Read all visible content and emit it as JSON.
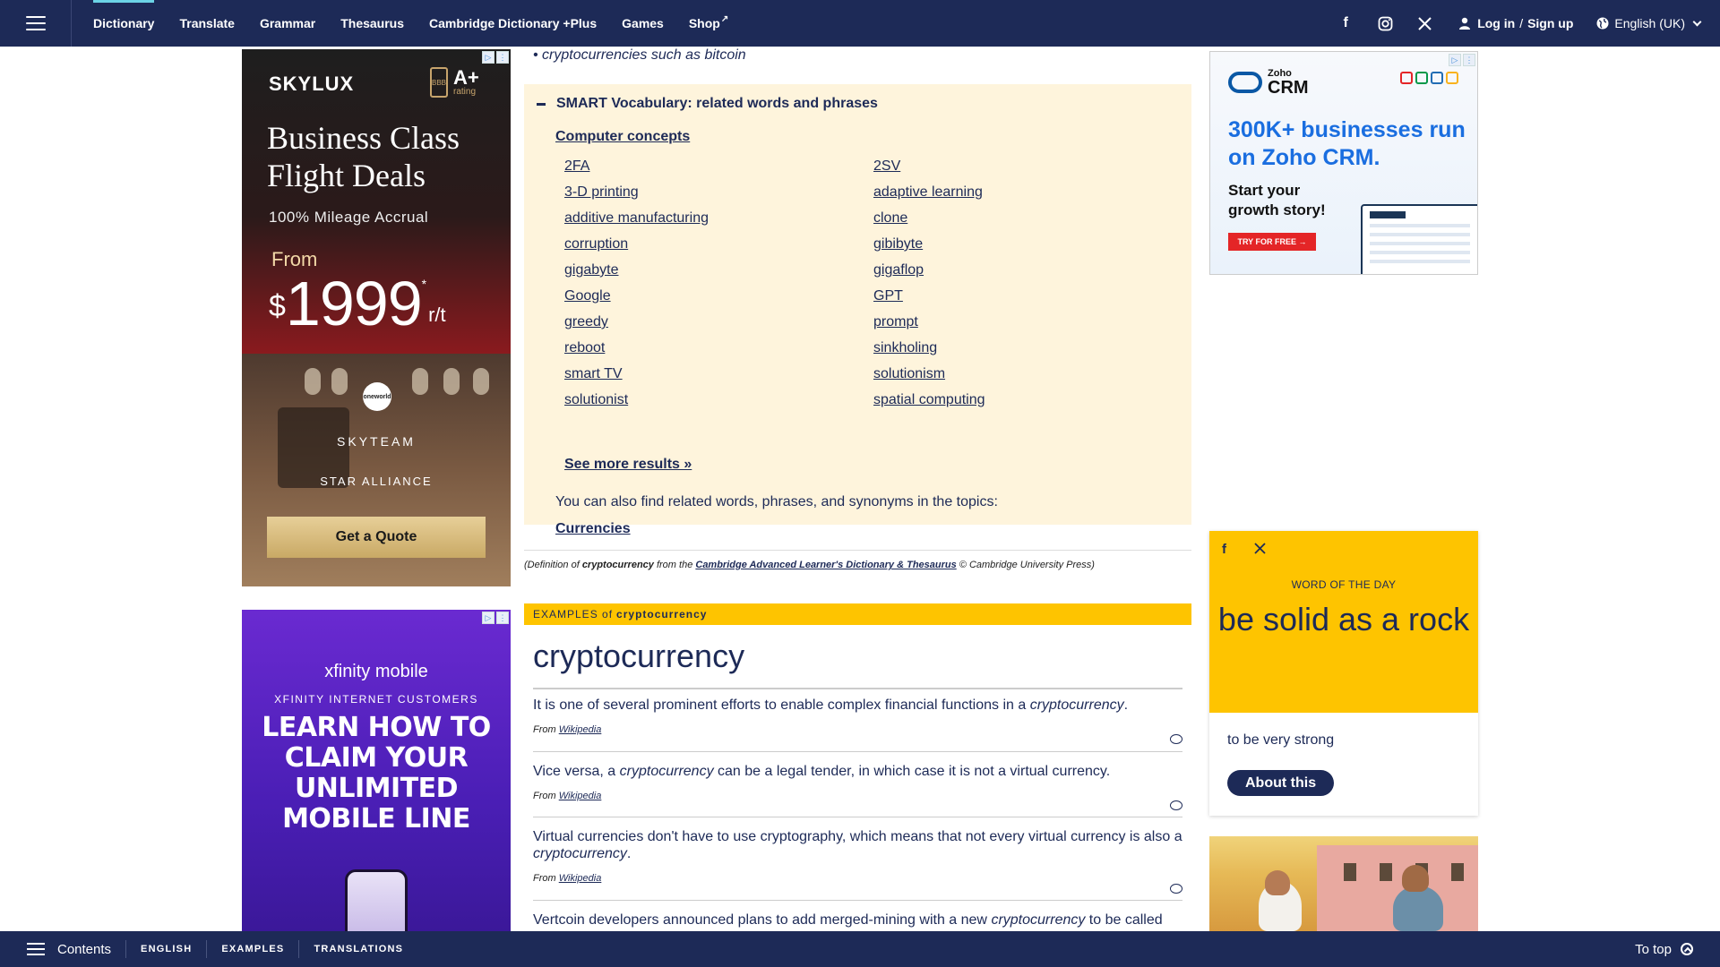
{
  "nav": {
    "items": [
      {
        "label": "Dictionary",
        "active": true
      },
      {
        "label": "Translate"
      },
      {
        "label": "Grammar"
      },
      {
        "label": "Thesaurus"
      },
      {
        "label": "Cambridge Dictionary +Plus"
      },
      {
        "label": "Games"
      },
      {
        "label": "Shop"
      }
    ],
    "social": [
      "facebook-icon",
      "instagram-icon",
      "x-icon"
    ],
    "login_label": "Log in",
    "signup_label": "Sign up",
    "language_label": "English (UK)"
  },
  "ads": {
    "skylux": {
      "brand": "SKYLUX",
      "rating_grade": "A+",
      "rating_word": "rating",
      "bbb": "BBB",
      "headline": "Business Class Flight Deals",
      "subtitle": "100% Mileage Accrual",
      "from": "From",
      "currency": "$",
      "price": "1999",
      "asterisk": "*",
      "suffix": "r/t",
      "oneworld": "oneworld",
      "skyteam": "SKYTEAM",
      "star_alliance": "STAR ALLIANCE",
      "cta": "Get a Quote"
    },
    "xfinity": {
      "logo": "xfinity mobile",
      "subtitle": "XFINITY INTERNET CUSTOMERS",
      "headline": "LEARN HOW TO CLAIM YOUR UNLIMITED MOBILE LINE"
    },
    "zoho": {
      "logo_small": "Zoho",
      "logo_big": "CRM",
      "headline": "300K+ businesses run on Zoho CRM.",
      "subtitle": "Start your growth story!",
      "cta": "TRY FOR FREE →",
      "colors": [
        "#e42527",
        "#089949",
        "#226db4",
        "#f9b21d"
      ]
    }
  },
  "entry": {
    "bullet": "cryptocurrencies such as bitcoin",
    "smart_title": "SMART Vocabulary: related words and phrases",
    "topic": "Computer concepts",
    "words_left": [
      "2FA",
      "3-D printing",
      "additive manufacturing",
      "corruption",
      "gigabyte",
      "Google",
      "greedy",
      "reboot",
      "smart TV",
      "solutionist"
    ],
    "words_right": [
      "2SV",
      "adaptive learning",
      "clone",
      "gibibyte",
      "gigaflop",
      "GPT",
      "prompt",
      "sinkholing",
      "solutionism",
      "spatial computing"
    ],
    "see_more": "See more results »",
    "also_text": "You can also find related words, phrases, and synonyms in the topics:",
    "also_topic": "Currencies",
    "source_pre": "(Definition of ",
    "source_word": "cryptocurrency",
    "source_mid": " from the ",
    "source_link": "Cambridge Advanced Learner's Dictionary & Thesaurus",
    "source_post": " © Cambridge University Press)"
  },
  "examples": {
    "bar_prefix": "EXAMPLES of",
    "bar_word": "cryptocurrency",
    "word": "cryptocurrency",
    "from_label": "From",
    "items": [
      {
        "pre": "It is one of several prominent efforts to enable complex financial functions in a ",
        "term": "cryptocurrency",
        "post": ".",
        "source": "Wikipedia"
      },
      {
        "pre": "Vice versa, a ",
        "term": "cryptocurrency",
        "post": " can be a legal tender, in which case it is not a virtual currency.",
        "source": "Wikipedia"
      },
      {
        "pre": "Virtual currencies don't have to use cryptography, which means that not every virtual currency is also a ",
        "term": "cryptocurrency",
        "post": ".",
        "source": "Wikipedia"
      },
      {
        "pre": "Vertcoin developers announced plans to add merged-mining with a new ",
        "term": "cryptocurrency",
        "post": " to be called",
        "source": ""
      }
    ]
  },
  "wotd": {
    "label": "WORD OF THE DAY",
    "word": "be solid as a rock",
    "definition": "to be very strong",
    "button": "About this"
  },
  "bottom": {
    "contents": "Contents",
    "links": [
      "ENGLISH",
      "EXAMPLES",
      "TRANSLATIONS"
    ],
    "to_top": "To top"
  }
}
